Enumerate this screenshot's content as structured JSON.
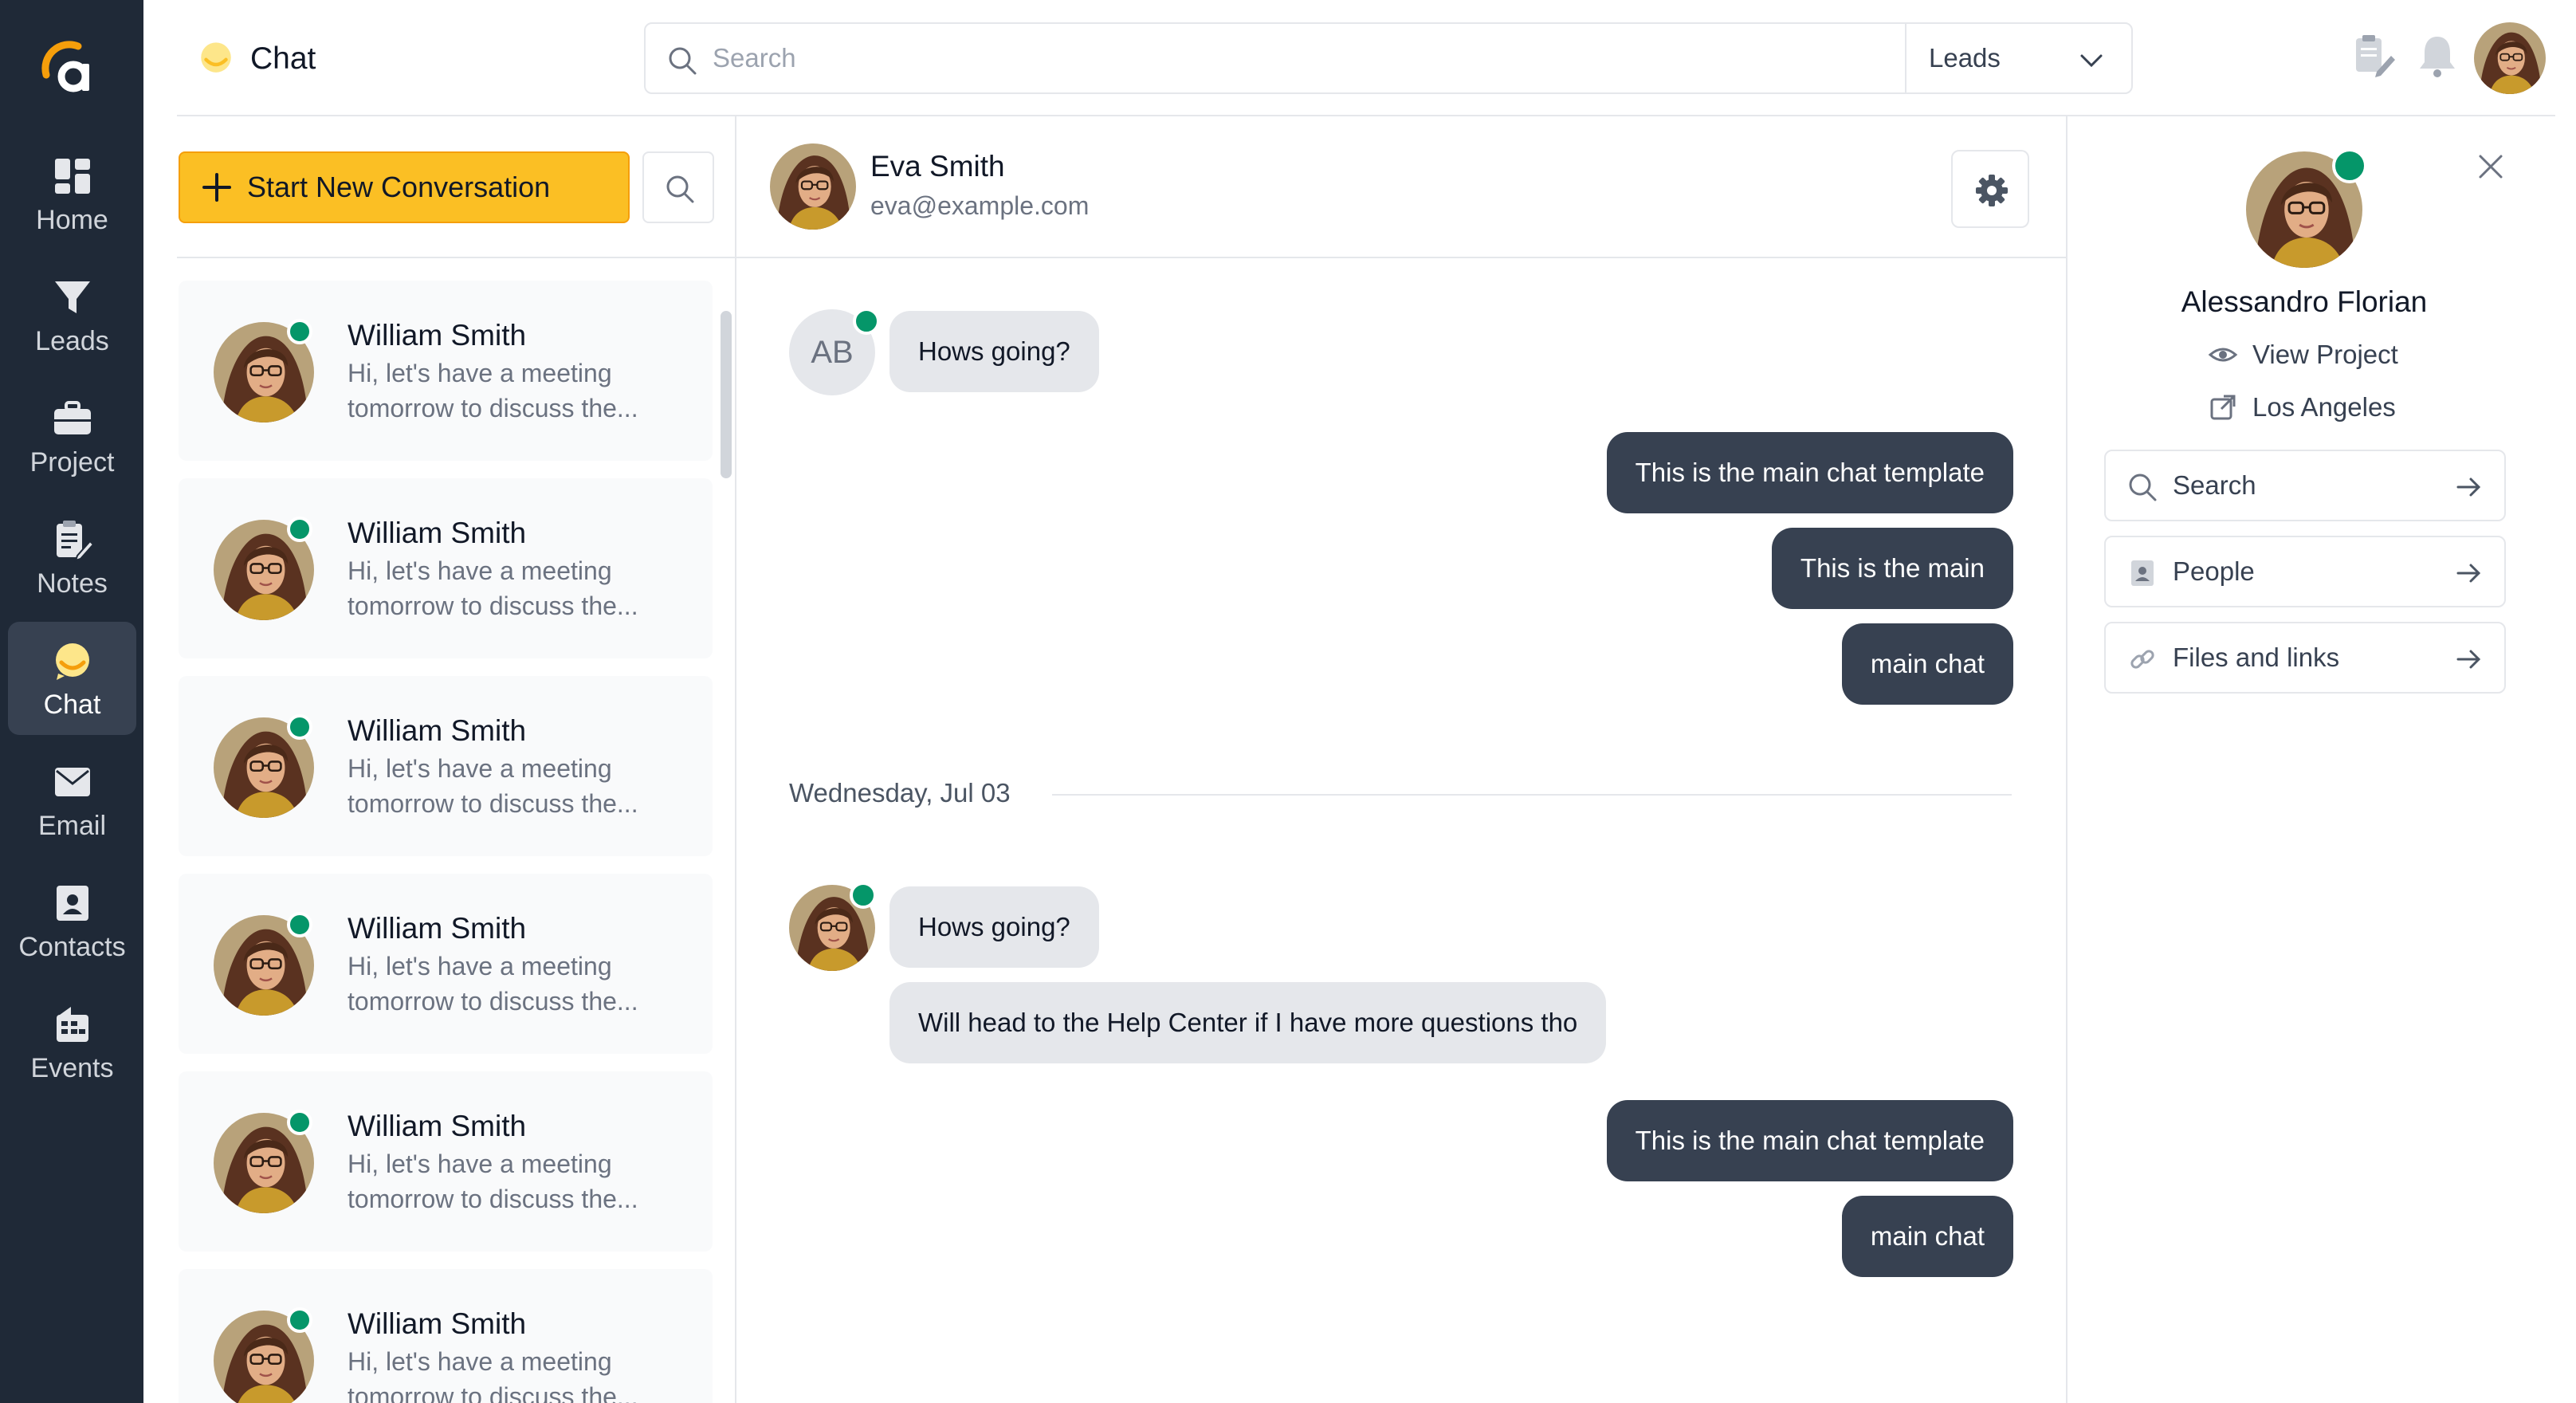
{
  "sidebar": {
    "items": [
      {
        "label": "Home",
        "icon": "home-icon"
      },
      {
        "label": "Leads",
        "icon": "filter-icon"
      },
      {
        "label": "Project",
        "icon": "briefcase-icon"
      },
      {
        "label": "Notes",
        "icon": "notes-icon"
      },
      {
        "label": "Chat",
        "icon": "chat-icon",
        "active": true
      },
      {
        "label": "Email",
        "icon": "mail-icon"
      },
      {
        "label": "Contacts",
        "icon": "contacts-icon"
      },
      {
        "label": "Events",
        "icon": "events-icon"
      }
    ]
  },
  "header": {
    "title": "Chat",
    "search_placeholder": "Search",
    "search_scope": "Leads"
  },
  "conversations": {
    "start_button_label": "Start New Conversation",
    "items": [
      {
        "name": "William Smith",
        "preview": "Hi, let's have a meeting tomorrow to discuss the...",
        "online": true
      },
      {
        "name": "William Smith",
        "preview": "Hi, let's have a meeting tomorrow to discuss the...",
        "online": true
      },
      {
        "name": "William Smith",
        "preview": "Hi, let's have a meeting tomorrow to discuss the...",
        "online": true
      },
      {
        "name": "William Smith",
        "preview": "Hi, let's have a meeting tomorrow to discuss the...",
        "online": true
      },
      {
        "name": "William Smith",
        "preview": "Hi, let's have a meeting tomorrow to discuss the...",
        "online": true
      },
      {
        "name": "William Smith",
        "preview": "Hi, let's have a meeting tomorrow to discuss the...",
        "online": true
      }
    ]
  },
  "chat": {
    "contact_name": "Eva Smith",
    "contact_email": "eva@example.com",
    "sender_initials": "AB",
    "date_separator": "Wednesday, Jul 03",
    "messages": [
      {
        "direction": "in",
        "text": "Hows going?"
      },
      {
        "direction": "out",
        "text": "This is the main chat template"
      },
      {
        "direction": "out",
        "text": "This is the main"
      },
      {
        "direction": "out",
        "text": "main chat"
      },
      {
        "direction": "in",
        "text": "Hows going?"
      },
      {
        "direction": "in",
        "text": "Will head to the Help Center if I have more questions tho"
      },
      {
        "direction": "out",
        "text": "This is the main chat template"
      },
      {
        "direction": "out",
        "text": "main chat"
      }
    ]
  },
  "profile": {
    "name": "Alessandro Florian",
    "view_project_label": "View Project",
    "location": "Los Angeles",
    "actions": [
      {
        "label": "Search",
        "icon": "search-icon"
      },
      {
        "label": "People",
        "icon": "contacts-icon"
      },
      {
        "label": "Files and links",
        "icon": "link-icon"
      }
    ]
  },
  "colors": {
    "sidebar_bg": "#1f2937",
    "accent": "#fbbf24",
    "online": "#059669",
    "outgoing_bubble": "#374151",
    "incoming_bubble": "#e5e7eb"
  }
}
